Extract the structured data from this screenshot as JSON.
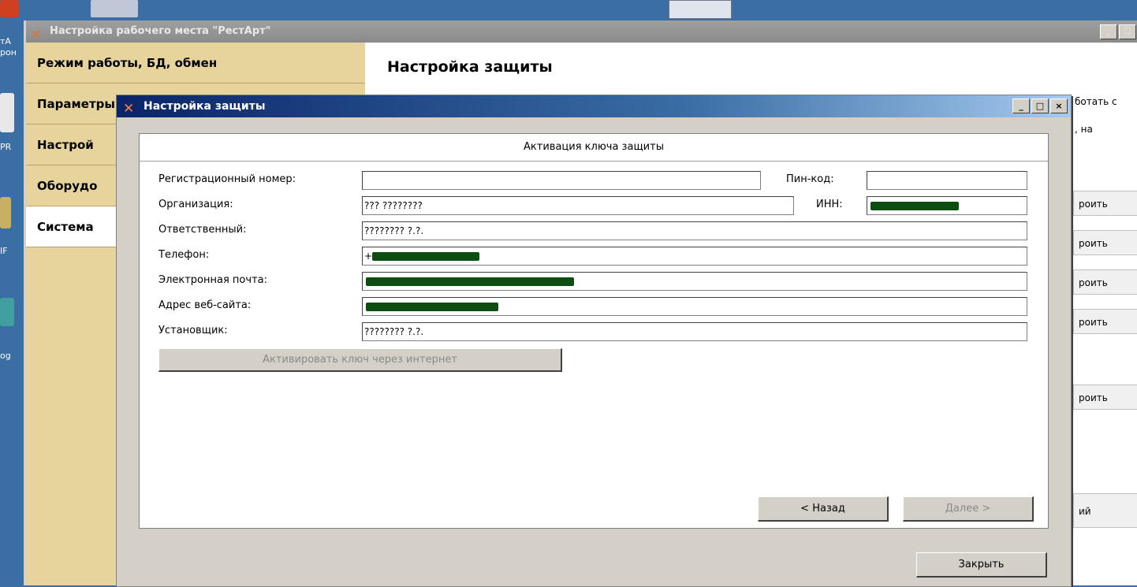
{
  "desktop": {
    "icon_labels": [
      "тА",
      "рон",
      "PR",
      "IF",
      "og"
    ]
  },
  "main_window": {
    "title": "Настройка рабочего места \"РестАрт\"",
    "controls": [
      "_",
      "□"
    ],
    "nav_items": [
      {
        "label": "Режим работы, БД, обмен",
        "selected": false
      },
      {
        "label": "Параметры",
        "selected": false
      },
      {
        "label": "Настрой",
        "selected": false
      },
      {
        "label": "Оборудо",
        "selected": false
      },
      {
        "label": "Система",
        "selected": true
      }
    ],
    "content_title": "Настройка защиты",
    "right_text": [
      "ботать с",
      ", на"
    ],
    "right_buttons": [
      "роить",
      "роить",
      "роить",
      "роить",
      "роить"
    ],
    "right_bottom_text": "ий"
  },
  "dialog": {
    "title": "Настройка защиты",
    "controls": [
      "_",
      "□",
      "×"
    ],
    "panel_header": "Активация ключа защиты",
    "fields": {
      "reg_number": {
        "label": "Регистрационный номер:",
        "value": ""
      },
      "pin": {
        "label": "Пин-код:",
        "value": ""
      },
      "organization": {
        "label": "Организация:",
        "value": "??? ????????"
      },
      "inn": {
        "label": "ИНН:",
        "value": ""
      },
      "responsible": {
        "label": "Ответственный:",
        "value": "???????? ?.?."
      },
      "phone": {
        "label": "Телефон:",
        "value": "+"
      },
      "email": {
        "label": "Электронная почта:",
        "value": ""
      },
      "website": {
        "label": "Адрес веб-сайта:",
        "value": ""
      },
      "installer": {
        "label": "Установщик:",
        "value": "???????? ?.?."
      }
    },
    "activate_button": "Активировать ключ через интернет",
    "back_button": "< Назад",
    "next_button": "Далее >",
    "close_button": "Закрыть"
  },
  "colors": {
    "desktop": "#3a6ea5",
    "nav_panel": "#e7d49c",
    "dialog_face": "#d4d0c8",
    "redaction": "#0d4d12"
  }
}
